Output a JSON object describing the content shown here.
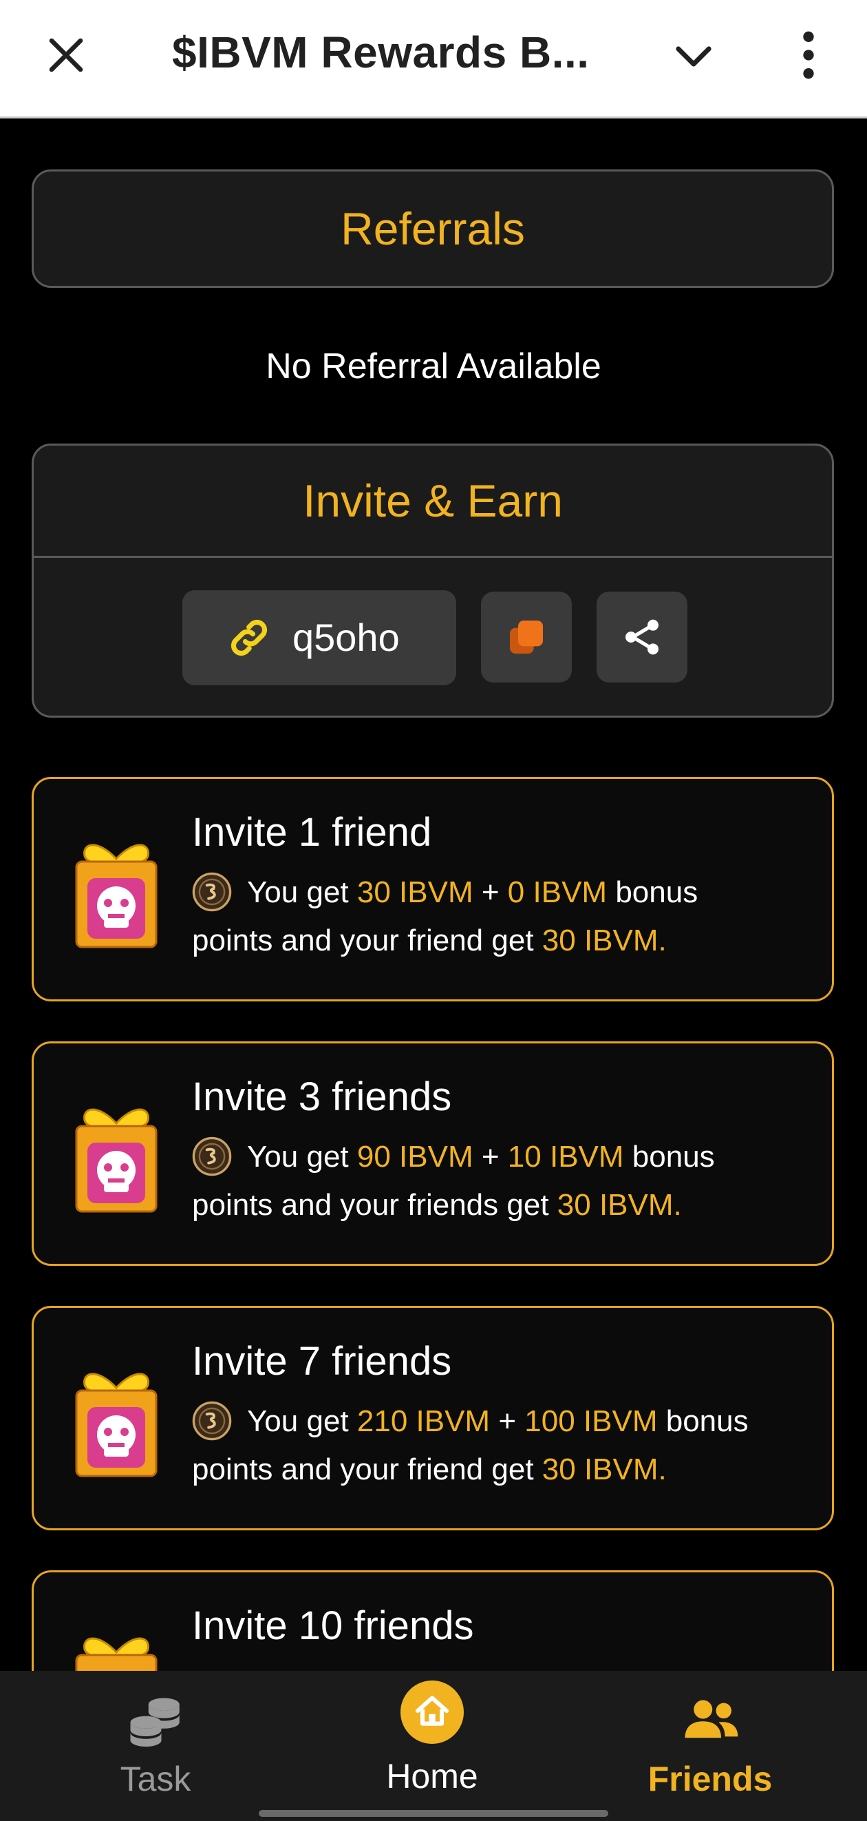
{
  "topbar": {
    "title": "$IBVM Rewards B..."
  },
  "referrals": {
    "title": "Referrals",
    "empty_text": "No Referral Available"
  },
  "invite": {
    "title": "Invite & Earn",
    "code": "q5oho"
  },
  "cards": [
    {
      "title": "Invite 1 friend",
      "you_get_prefix": "You get",
      "amount": "30 IBVM",
      "plus": "+",
      "bonus": "0 IBVM",
      "bonus_word": "bonus",
      "line2": "points and your friend get",
      "friend_amount": "30 IBVM."
    },
    {
      "title": "Invite 3 friends",
      "you_get_prefix": "You get",
      "amount": "90 IBVM",
      "plus": "+",
      "bonus": "10 IBVM",
      "bonus_word": "bonus",
      "line2": "points and your friends get",
      "friend_amount": "30 IBVM."
    },
    {
      "title": "Invite 7 friends",
      "you_get_prefix": "You get",
      "amount": "210 IBVM",
      "plus": "+",
      "bonus": "100 IBVM",
      "bonus_word": "bonus",
      "line2": "points and your friend get",
      "friend_amount": "30 IBVM."
    },
    {
      "title": "Invite 10 friends"
    }
  ],
  "nav": {
    "task": "Task",
    "home": "Home",
    "friends": "Friends",
    "active": "friends"
  },
  "colors": {
    "accent": "#f2b320",
    "card_border": "#e5a522",
    "copy_icon": "#f0731a",
    "background": "#000000",
    "panel": "#1b1b1b"
  },
  "icons": {
    "close": "close-icon",
    "chevron": "chevron-down-icon",
    "menu": "more-vertical-icon",
    "link": "link-icon",
    "copy": "copy-icon",
    "share": "share-icon",
    "gift": "gift-box-icon",
    "coin": "ibvm-coin-icon",
    "task": "coins-stack-icon",
    "home": "home-icon",
    "friends": "users-icon"
  }
}
